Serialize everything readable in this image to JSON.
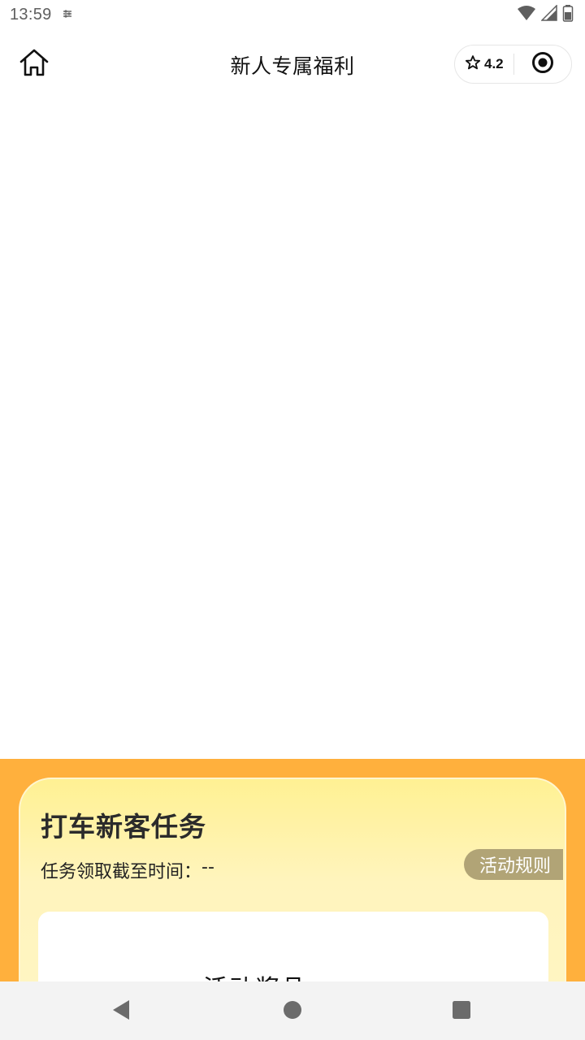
{
  "status_bar": {
    "time": "13:59",
    "icons": [
      "data-sync-icon",
      "wifi-icon",
      "signal-icon",
      "battery-icon"
    ]
  },
  "nav": {
    "title": "新人专属福利",
    "rating": "4.2",
    "icons": [
      "home-icon",
      "star-icon",
      "target-icon"
    ]
  },
  "task_card": {
    "title": "打车新客任务",
    "deadline_label": "任务领取截至时间：",
    "deadline_value": "--",
    "rules_button": "活动规则",
    "reward_title": "活动奖品"
  },
  "colors": {
    "promo_background": "#ffb03d",
    "card_top": "#fff193",
    "card_bottom": "#fff6c4",
    "rules_button": "#b1a476",
    "system_nav": "#f3f3f3"
  },
  "system_nav": {
    "icons": [
      "back-icon",
      "home-circle-icon",
      "recents-icon"
    ]
  }
}
